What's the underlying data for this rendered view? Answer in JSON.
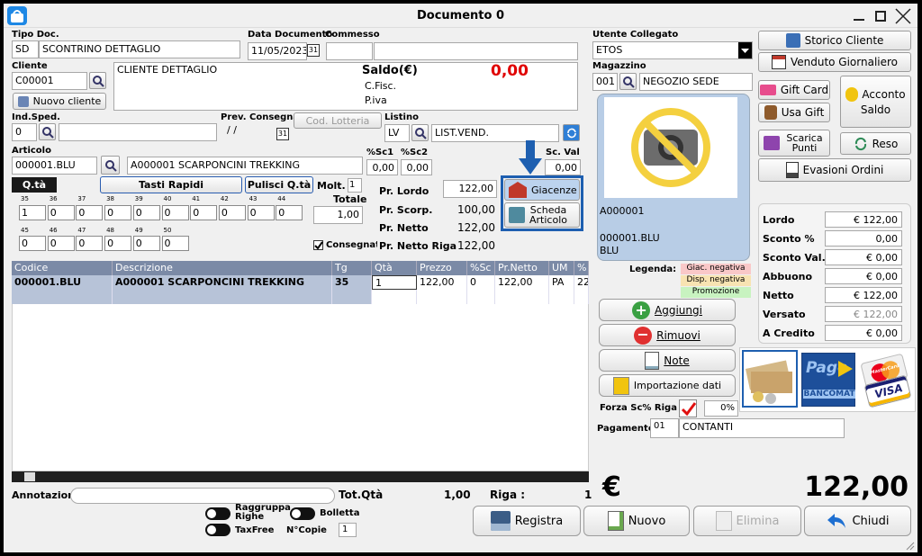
{
  "window": {
    "title": "Documento 0"
  },
  "header": {
    "tipo_doc_label": "Tipo Doc.",
    "tipo_doc_code": "SD",
    "tipo_doc_desc": "SCONTRINO DETTAGLIO",
    "data_doc_label": "Data Documento",
    "data_doc_value": "11/05/2023",
    "commesso_label": "Commesso",
    "commesso_value": "",
    "cliente_label": "Cliente",
    "cliente_code": "C00001",
    "cliente_name": "CLIENTE DETTAGLIO",
    "nuovo_cliente_label": "Nuovo cliente",
    "saldo_label": "Saldo(€)",
    "saldo_value": "0,00",
    "cfisc_label": "C.Fisc.",
    "piva_label": "P.iva",
    "ind_sped_label": "Ind.Sped.",
    "ind_sped_code": "0",
    "prev_consegna_label": "Prev. Consegna",
    "prev_consegna_value": "/ /",
    "cod_lotteria_label": "Cod. Lotteria",
    "listino_label": "Listino",
    "listino_code": "LV",
    "listino_desc": "LIST.VEND."
  },
  "articolo": {
    "label": "Articolo",
    "code": "000001.BLU",
    "desc": "A000001 SCARPONCINI TREKKING",
    "sc1_label": "%Sc1",
    "sc1_value": "0,00",
    "sc2_label": "%Sc2",
    "sc2_value": "0,00",
    "scval_label": "Sc. Val",
    "scval_value": "0,00",
    "qta_tab": "Q.tà",
    "tasti_rapidi": "Tasti Rapidi",
    "pulisci_qta": "Pulisci Q.tà",
    "molt_label": "Molt.",
    "molt_value": "1",
    "totale_label": "Totale",
    "totale_value": "1,00",
    "consegnato_label": "Consegnato",
    "sizes_row1": [
      {
        "size": "35",
        "qty": "1"
      },
      {
        "size": "36",
        "qty": "0"
      },
      {
        "size": "37",
        "qty": "0"
      },
      {
        "size": "38",
        "qty": "0"
      },
      {
        "size": "39",
        "qty": "0"
      },
      {
        "size": "40",
        "qty": "0"
      },
      {
        "size": "41",
        "qty": "0"
      },
      {
        "size": "42",
        "qty": "0"
      },
      {
        "size": "43",
        "qty": "0"
      },
      {
        "size": "44",
        "qty": "0"
      }
    ],
    "sizes_row2": [
      {
        "size": "45",
        "qty": "0"
      },
      {
        "size": "46",
        "qty": "0"
      },
      {
        "size": "47",
        "qty": "0"
      },
      {
        "size": "48",
        "qty": "0"
      },
      {
        "size": "49",
        "qty": "0"
      },
      {
        "size": "50",
        "qty": "0"
      }
    ],
    "pr_lordo_label": "Pr. Lordo",
    "pr_lordo_value": "122,00",
    "pr_scorp_label": "Pr. Scorp.",
    "pr_scorp_value": "100,00",
    "pr_netto_label": "Pr. Netto",
    "pr_netto_value": "122,00",
    "pr_netto_riga_label": "Pr. Netto Riga",
    "pr_netto_riga_value": "122,00",
    "giacenze_label": "Giacenze",
    "scheda_articolo_label": "Scheda\nArticolo"
  },
  "table": {
    "headers": [
      "Codice",
      "Descrizione",
      "Tg",
      "Qtà",
      "Prezzo",
      "%Sc",
      "Pr.Netto",
      "UM",
      "%"
    ],
    "row": [
      "000001.BLU",
      "A000001 SCARPONCINI TREKKING",
      "35",
      "1",
      "122,00",
      "0",
      "122,00",
      "PA",
      "22"
    ]
  },
  "footer": {
    "annotazioni_label": "Annotazioni",
    "tot_qta_label": "Tot.Qtà",
    "tot_qta_value": "1,00",
    "riga_label": "Riga :",
    "riga_value": "1",
    "raggruppa_label": "Raggruppa Righe",
    "bolletta_label": "Bolletta",
    "taxfree_label": "TaxFree",
    "ncopie_label": "N°Copie",
    "ncopie_value": "1",
    "currency": "€",
    "total": "122,00",
    "registra": "Registra",
    "nuovo": "Nuovo",
    "elimina": "Elimina",
    "chiudi": "Chiudi"
  },
  "right": {
    "utente_label": "Utente Collegato",
    "utente_value": "ETOS",
    "magazzino_label": "Magazzino",
    "magazzino_code": "001",
    "magazzino_desc": "NEGOZIO SEDE",
    "art_code": "A000001",
    "art_variant": "000001.BLU",
    "art_color": "BLU",
    "legenda_label": "Legenda:",
    "leg_giac": "Giac. negativa",
    "leg_disp": "Disp. negativa",
    "leg_promo": "Promozione",
    "aggiungi": "Aggiungi",
    "rimuovi": "Rimuovi",
    "note": "Note",
    "importazione": "Importazione dati",
    "forza_label": "Forza Sc% Riga",
    "forza_value": "0%",
    "pagamento_label": "Pagamento",
    "pagamento_code": "01",
    "pagamento_desc": "CONTANTI"
  },
  "side": {
    "storico_cliente": "Storico Cliente",
    "venduto_giornaliero": "Venduto Giornaliero",
    "gift_card": "Gift Card",
    "usa_gift": "Usa Gift",
    "acconto": "Acconto",
    "saldo": "Saldo",
    "scarica_punti": "Scarica Punti",
    "reso": "Reso",
    "evasioni_ordini": "Evasioni Ordini",
    "lordo_label": "Lordo",
    "lordo_value": "€ 122,00",
    "sconto_pct_label": "Sconto %",
    "sconto_pct_value": "0,00",
    "sconto_val_label": "Sconto Val.",
    "sconto_val_value": "€ 0,00",
    "abbuono_label": "Abbuono",
    "abbuono_value": "€ 0,00",
    "netto_label": "Netto",
    "netto_value": "€ 122,00",
    "versato_label": "Versato",
    "versato_value": "€ 122,00",
    "a_credito_label": "A Credito",
    "a_credito_value": "€ 0,00",
    "pago_text": "Pago",
    "bancomat_text": "BANCOMAT",
    "visa_text": "VISA",
    "mastercard_text": "MasterCard"
  }
}
